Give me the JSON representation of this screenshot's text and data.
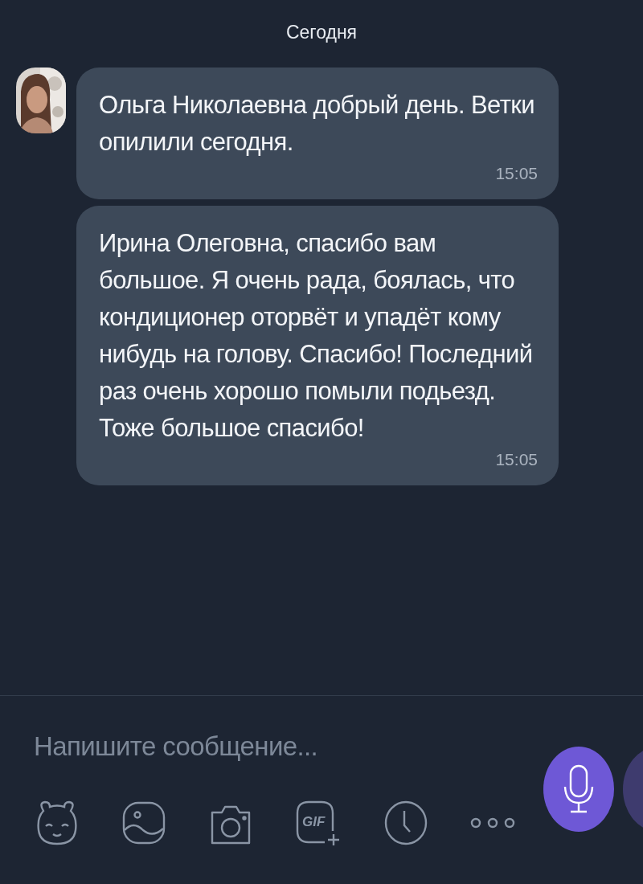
{
  "date_separator": "Сегодня",
  "messages": [
    {
      "text": "Ольга Николаевна добрый день. Ветки опилили сегодня.",
      "time": "15:05"
    },
    {
      "text": "Ирина Олеговна, спасибо вам большое. Я очень рада, боялась, что кондиционер оторвёт и упадёт кому нибудь на голову. Спасибо! Последний раз очень хорошо помыли подьезд. Тоже большое спасибо!",
      "time": "15:05"
    }
  ],
  "composer": {
    "placeholder": "Напишите сообщение...",
    "gif_label": "GIF"
  }
}
